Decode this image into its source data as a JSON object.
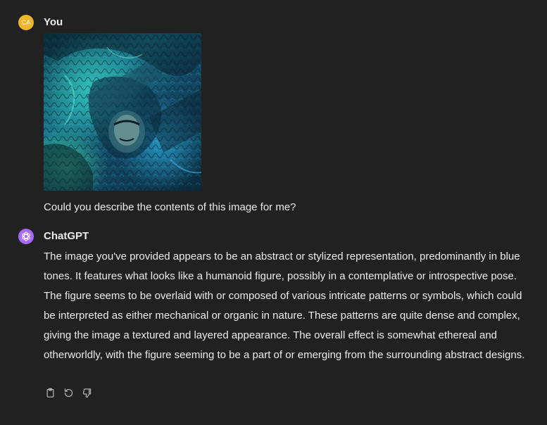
{
  "conversation": {
    "user": {
      "avatar_initials": "CA",
      "author": "You",
      "text": "Could you describe the contents of this image for me?"
    },
    "assistant": {
      "author": "ChatGPT",
      "text": "The image you've provided appears to be an abstract or stylized representation, predominantly in blue tones. It features what looks like a humanoid figure, possibly in a contemplative or introspective pose. The figure seems to be overlaid with or composed of various intricate patterns or symbols, which could be interpreted as either mechanical or organic in nature. These patterns are quite dense and complex, giving the image a textured and layered appearance. The overall effect is somewhat ethereal and otherworldly, with the figure seeming to be a part of or emerging from the surrounding abstract designs."
    }
  },
  "actions": [
    {
      "icon": "clipboard-icon"
    },
    {
      "icon": "regenerate-icon"
    },
    {
      "icon": "thumbs-down-icon"
    }
  ],
  "colors": {
    "background": "#212121",
    "text": "#ececec",
    "user_avatar": "#f0b429",
    "assistant_avatar": "#ab68ff",
    "icon": "#b4b4b4"
  }
}
